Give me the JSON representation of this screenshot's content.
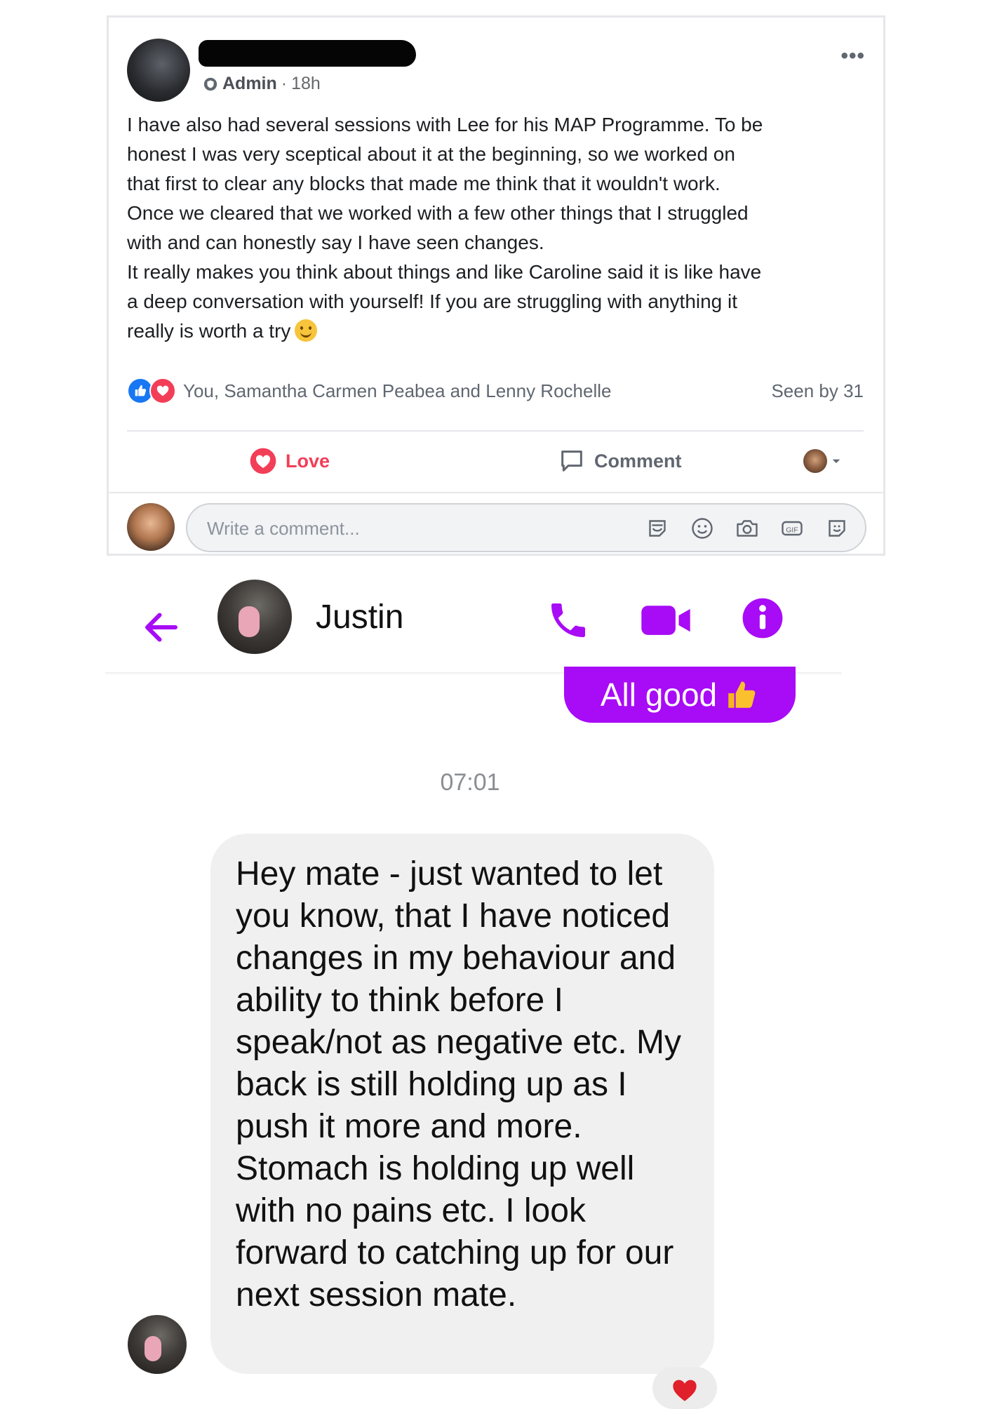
{
  "fb_post": {
    "role": "Admin",
    "time_sep": "·",
    "time": "18h",
    "more": "•••",
    "body": "I have also had several sessions with Lee for his MAP Programme. To be\nhonest I was very sceptical about it at the beginning, so we worked on\nthat first to clear any blocks that made me think that it wouldn't work.\nOnce we cleared that we worked with a few other things that I struggled\nwith and can honestly say I have seen changes.\nIt really makes you think about things and like Caroline said it is like have\na deep conversation with yourself! If you are struggling with anything it\nreally is worth a try",
    "reactions_names": "You, Samantha Carmen Peabea and Lenny Rochelle",
    "seen": "Seen by 31",
    "love_label": "Love",
    "comment_label": "Comment",
    "comment_placeholder": "Write a comment...",
    "icons": [
      "shield-icon",
      "like-icon",
      "heart-icon",
      "comment-icon",
      "sticker-icon",
      "emoji-icon",
      "camera-icon",
      "gif-icon",
      "avatar-sticker-icon"
    ],
    "colors": {
      "like": "#1877f2",
      "love": "#f33e58"
    }
  },
  "messenger": {
    "contact_name": "Justin",
    "sent_message": "All good",
    "time": "07:01",
    "received_message": "Hey mate - just wanted to let you know, that I have noticed changes in my behaviour and ability to think before I speak/not as negative etc. My back is still holding up as I push it more and more. Stomach is holding up well with no pains etc. I look forward to catching up for our next session mate.",
    "icons": [
      "back-arrow-icon",
      "phone-icon",
      "video-icon",
      "info-icon",
      "thumbs-up-icon",
      "heart-reaction-icon"
    ],
    "colors": {
      "accent": "#a80bf6"
    }
  }
}
